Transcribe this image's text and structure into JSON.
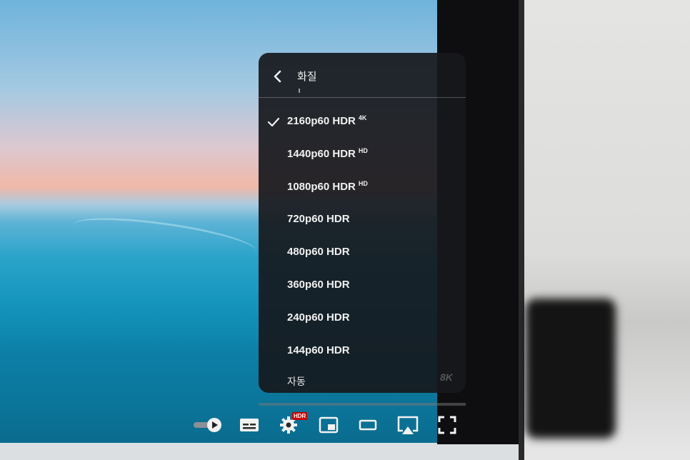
{
  "menu": {
    "title": "화질",
    "options": [
      {
        "label": "2160p60 HDR",
        "badge": "4K",
        "selected": true
      },
      {
        "label": "1440p60 HDR",
        "badge": "HD",
        "selected": false
      },
      {
        "label": "1080p60 HDR",
        "badge": "HD",
        "selected": false
      },
      {
        "label": "720p60 HDR",
        "badge": "",
        "selected": false
      },
      {
        "label": "480p60 HDR",
        "badge": "",
        "selected": false
      },
      {
        "label": "360p60 HDR",
        "badge": "",
        "selected": false
      },
      {
        "label": "240p60 HDR",
        "badge": "",
        "selected": false
      },
      {
        "label": "144p60 HDR",
        "badge": "",
        "selected": false
      }
    ],
    "auto_label": "자동",
    "faded_tag": "8K"
  },
  "controls": {
    "settings_badge": "HDR",
    "icons": [
      "autoplay-toggle-icon",
      "subtitles-icon",
      "settings-gear-icon",
      "miniplayer-icon",
      "theater-mode-icon",
      "airplay-icon",
      "fullscreen-icon"
    ]
  },
  "colors": {
    "menu_bg": "#16181c",
    "text": "#f1f1f1",
    "hdr_badge": "#cc0000"
  }
}
